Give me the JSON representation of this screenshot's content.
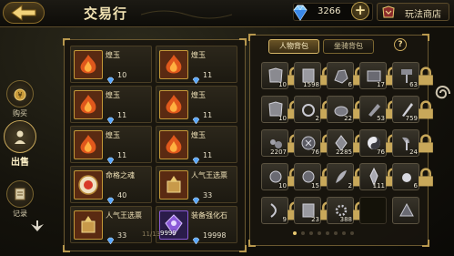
{
  "header": {
    "title": "交易行",
    "currency_value": "3266",
    "shop_label": "玩法商店"
  },
  "nav": {
    "buy": "购买",
    "sell": "出售",
    "records": "记录"
  },
  "sell_items": [
    {
      "name": "煌玉",
      "price": "10",
      "icon": "fire-gem-icon"
    },
    {
      "name": "煌玉",
      "price": "11",
      "icon": "fire-gem-icon"
    },
    {
      "name": "煌玉",
      "price": "11",
      "icon": "fire-gem-icon"
    },
    {
      "name": "煌玉",
      "price": "11",
      "icon": "fire-gem-icon"
    },
    {
      "name": "煌玉",
      "price": "11",
      "icon": "fire-gem-icon"
    },
    {
      "name": "煌玉",
      "price": "11",
      "icon": "fire-gem-icon"
    },
    {
      "name": "命格之魂",
      "price": "40",
      "icon": "soul-orb-icon"
    },
    {
      "name": "人气王选票",
      "price": "33",
      "icon": "ballot-icon"
    },
    {
      "name": "人气王选票",
      "price": "33",
      "icon": "ballot-icon"
    },
    {
      "name": "装备强化石",
      "price": "19998",
      "icon": "enhance-stone-icon",
      "qty": "9999"
    }
  ],
  "pager_text": "11/13",
  "tabs": {
    "character_bag": "人物背包",
    "mount_bag": "坐骑背包"
  },
  "help_label": "?",
  "bag": [
    {
      "qty": "10",
      "icon": "armor-icon",
      "locked": true
    },
    {
      "qty": "1598",
      "icon": "scroll-icon",
      "locked": true
    },
    {
      "qty": "6",
      "icon": "ore-icon",
      "locked": true
    },
    {
      "qty": "17",
      "icon": "box-icon",
      "locked": true
    },
    {
      "qty": "63",
      "icon": "hammer-icon",
      "locked": true
    },
    {
      "qty": "10",
      "icon": "armor-icon",
      "locked": true
    },
    {
      "qty": "2",
      "icon": "ring-icon",
      "locked": true
    },
    {
      "qty": "22",
      "icon": "stone-icon",
      "locked": true
    },
    {
      "qty": "53",
      "icon": "tool-icon",
      "locked": true
    },
    {
      "qty": "759",
      "icon": "blade-icon",
      "locked": true
    },
    {
      "qty": "2207",
      "icon": "dust-icon",
      "locked": true
    },
    {
      "qty": "76",
      "icon": "rune-icon",
      "locked": true
    },
    {
      "qty": "2285",
      "icon": "shard-icon",
      "locked": true
    },
    {
      "qty": "76",
      "icon": "yinyang-icon",
      "locked": true
    },
    {
      "qty": "24",
      "icon": "axe-icon",
      "locked": true
    },
    {
      "qty": "10",
      "icon": "orb-icon",
      "locked": true
    },
    {
      "qty": "15",
      "icon": "orb-icon",
      "locked": true
    },
    {
      "qty": "2",
      "icon": "feather-icon",
      "locked": true
    },
    {
      "qty": "111",
      "icon": "crystal-icon",
      "locked": true
    },
    {
      "qty": "6",
      "icon": "pearl-icon",
      "locked": true
    },
    {
      "qty": "9",
      "icon": "bow-icon",
      "locked": true
    },
    {
      "qty": "23",
      "icon": "scroll-icon",
      "locked": true
    },
    {
      "qty": "388",
      "icon": "gear-icon",
      "locked": true
    },
    {
      "qty": "",
      "icon": "",
      "locked": false,
      "empty": true
    },
    {
      "qty": "",
      "icon": "pyramid-icon",
      "locked": false
    }
  ],
  "page_dots": 8,
  "active_dot": 0,
  "colors": {
    "gold": "#c8a85a",
    "panel": "#18150e",
    "fire": "#e0581c",
    "crystal": "#5aa8ff"
  }
}
